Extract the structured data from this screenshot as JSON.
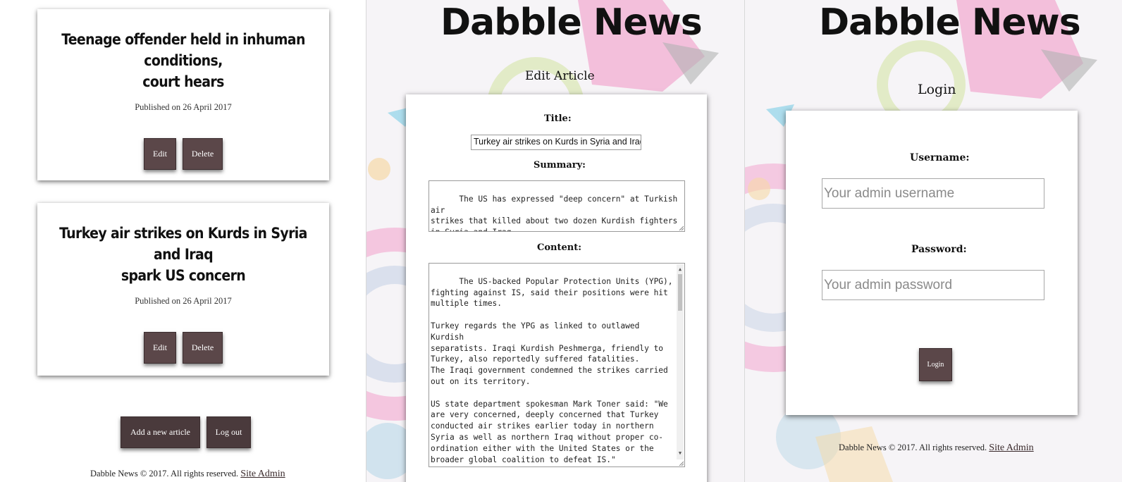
{
  "list_panel": {
    "articles": [
      {
        "title_line1": "Teenage offender held in inhuman conditions,",
        "title_line2": "court hears",
        "published": "Published on 26 April 2017",
        "edit_label": "Edit",
        "delete_label": "Delete"
      },
      {
        "title_line1": "Turkey air strikes on Kurds in Syria and Iraq",
        "title_line2": "spark US concern",
        "published": "Published on 26 April 2017",
        "edit_label": "Edit",
        "delete_label": "Delete"
      }
    ],
    "add_article_label": "Add a new article",
    "logout_label": "Log out",
    "footer_text": "Dabble News © 2017. All rights reserved.",
    "footer_link": "Site Admin"
  },
  "edit_panel": {
    "brand": "Dabble News",
    "heading": "Edit Article",
    "title_label": "Title:",
    "title_value": "Turkey air strikes on Kurds in Syria and Iraq :",
    "summary_label": "Summary:",
    "summary_value": "The US has expressed \"deep concern\" at Turkish air\nstrikes that killed about two dozen Kurdish fighters\nin Syria and Iraq.",
    "content_label": "Content:",
    "content_value": "The US-backed Popular Protection Units (YPG),\nfighting against IS, said their positions were hit\nmultiple times.\n\nTurkey regards the YPG as linked to outlawed Kurdish\nseparatists. Iraqi Kurdish Peshmerga, friendly to\nTurkey, also reportedly suffered fatalities.\nThe Iraqi government condemned the strikes carried\nout on its territory.\n\nUS state department spokesman Mark Toner said: \"We\nare very concerned, deeply concerned that Turkey\nconducted air strikes earlier today in northern\nSyria as well as northern Iraq without proper co-\nordination either with the United States or the\nbroader global coalition to defeat IS.\"\nHe added: \"We have expressed those concerns to the\ngovernment of Turkey directly.\""
  },
  "login_panel": {
    "brand": "Dabble News",
    "heading": "Login",
    "username_label": "Username:",
    "username_placeholder": "Your admin username",
    "password_label": "Password:",
    "password_placeholder": "Your admin password",
    "login_label": "Login",
    "footer_text": "Dabble News © 2017. All rights reserved.",
    "footer_link": "Site Admin"
  },
  "colors": {
    "button": "#5b4749",
    "button_dark": "#4a3a3c"
  }
}
